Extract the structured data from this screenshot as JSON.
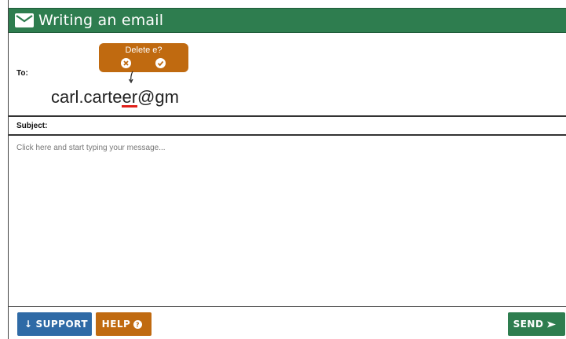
{
  "header": {
    "title": "Writing an email",
    "icon": "mail-icon"
  },
  "to": {
    "label": "To:",
    "value_before": "carl.carte",
    "value_highlight": "er",
    "value_after": "@gm"
  },
  "tooltip": {
    "text": "Delete e?",
    "cancel_icon": "x-circle-icon",
    "confirm_icon": "check-circle-icon"
  },
  "subject": {
    "label": "Subject:"
  },
  "message": {
    "placeholder": "Click here and start typing your message..."
  },
  "footer": {
    "support_label": "SUPPORT",
    "help_label": "HELP",
    "send_label": "SEND"
  },
  "colors": {
    "header": "#2e7d4f",
    "support": "#2f6aa6",
    "help": "#c06a10",
    "send": "#2e7d4f",
    "error_underline": "#e0201a"
  }
}
